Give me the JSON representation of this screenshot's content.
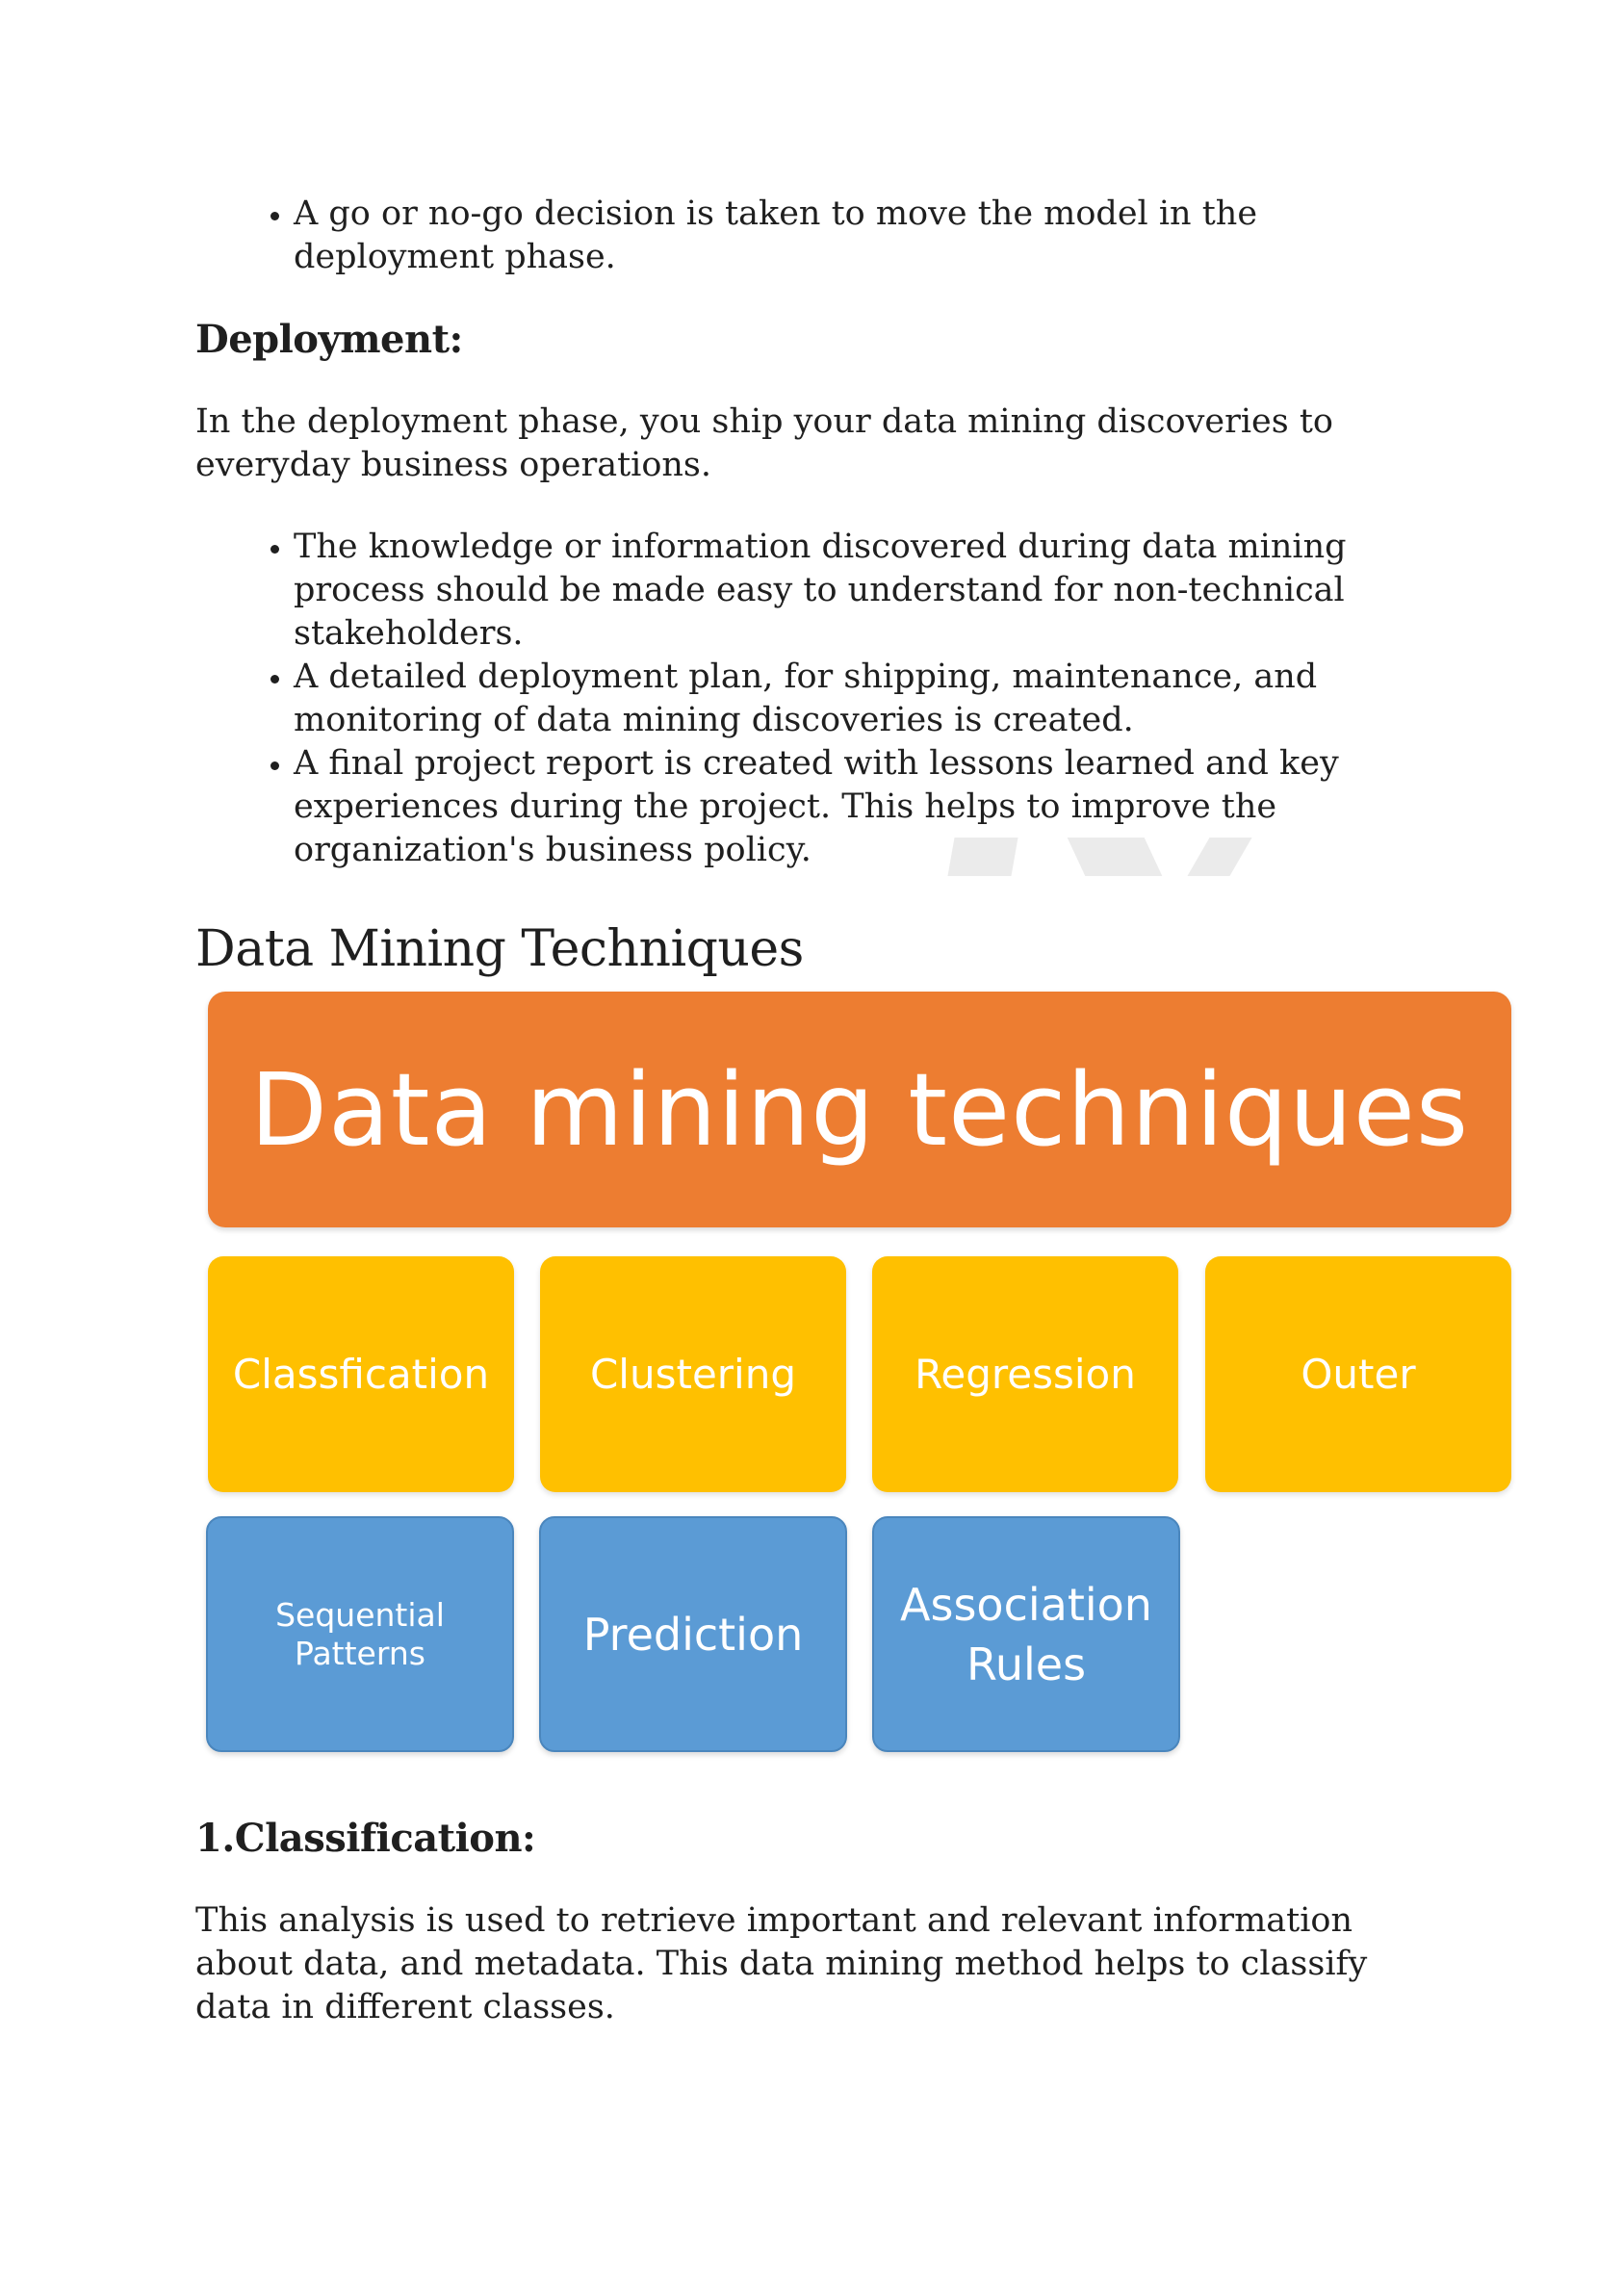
{
  "intro_bullets": [
    "A go or no-go decision is taken to move the model in the deployment phase."
  ],
  "deployment": {
    "heading": "Deployment:",
    "paragraph": "In the deployment phase, you ship your data mining discoveries to everyday business operations.",
    "bullets": [
      "The knowledge or information discovered during data mining process should be made easy to understand for non-technical stakeholders.",
      "A detailed deployment plan, for shipping, maintenance, and monitoring of data mining discoveries is created.",
      "A final project report is created with lessons learned and key experiences during the project. This helps to improve the organization's business policy."
    ]
  },
  "techniques": {
    "heading": "Data Mining Techniques",
    "diagram": {
      "title": "Data mining techniques",
      "row1": [
        "Classfication",
        "Clustering",
        "Regression",
        "Outer"
      ],
      "row2_a_line1": "Sequential",
      "row2_a_line2": "Patterns",
      "row2_b": "Prediction",
      "row2_c_line1": "Association",
      "row2_c_line2": "Rules",
      "colors": {
        "banner": "#ed7d31",
        "yellow": "#ffc000",
        "blue": "#5b9bd5"
      }
    }
  },
  "classification": {
    "heading": "1.Classification:",
    "paragraph": "This analysis is used to retrieve important and relevant information about data, and metadata. This data mining method helps to classify data in different classes."
  }
}
